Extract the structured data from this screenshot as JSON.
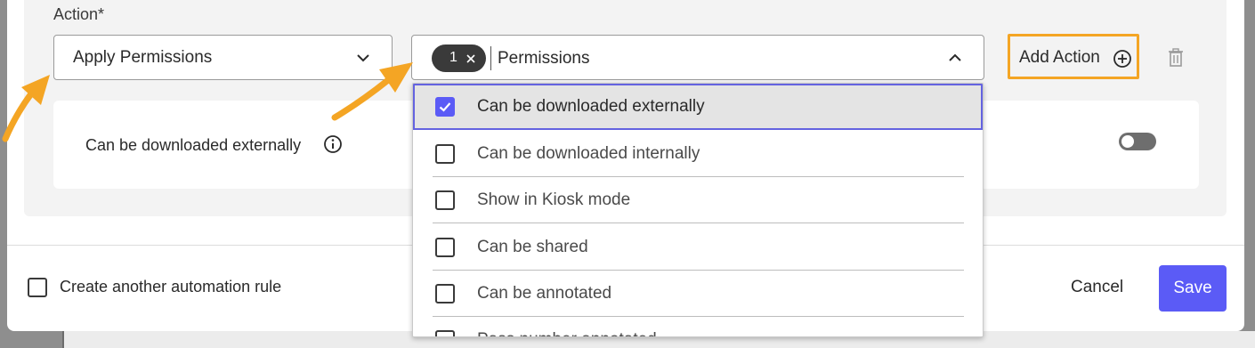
{
  "action": {
    "label": "Action*",
    "selected_action": "Apply Permissions",
    "permissions": {
      "chip_count": "1",
      "label": "Permissions"
    },
    "add_action_label": "Add Action"
  },
  "rule": {
    "label": "Can be downloaded externally",
    "toggle_on": false
  },
  "dropdown": {
    "options": [
      {
        "label": "Can be downloaded externally",
        "checked": true
      },
      {
        "label": "Can be downloaded internally",
        "checked": false
      },
      {
        "label": "Show in Kiosk mode",
        "checked": false
      },
      {
        "label": "Can be shared",
        "checked": false
      },
      {
        "label": "Can be annotated",
        "checked": false
      },
      {
        "label": "Pass number annotated",
        "checked": false
      }
    ]
  },
  "footer": {
    "create_another_label": "Create another automation rule",
    "cancel_label": "Cancel",
    "save_label": "Save"
  },
  "colors": {
    "accent": "#5b5bf6",
    "highlight": "#f4a524"
  },
  "icons": [
    "chevron-down-icon",
    "chevron-up-icon",
    "close-icon",
    "plus-circle-icon",
    "trash-icon",
    "info-icon",
    "checkmark-icon",
    "arrow-annotation"
  ]
}
